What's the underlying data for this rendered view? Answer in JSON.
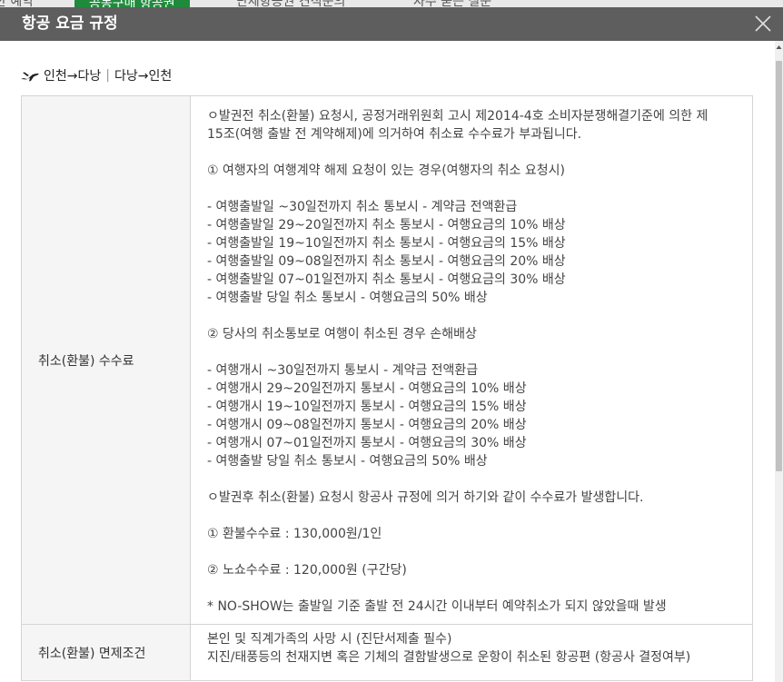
{
  "background_tabs": [
    "한 예약",
    "공동구매 항공권",
    "단체항공권 견적문의",
    "자주 묻는 질문"
  ],
  "modal": {
    "title": "항공 요금 규정",
    "close_icon": "close-icon"
  },
  "route": {
    "icon": "airplane-icon",
    "outbound": "인천→다낭",
    "separator": "|",
    "inbound": "다낭→인천"
  },
  "fare_rules": [
    {
      "label": "취소(환불) 수수료",
      "lines": [
        "ㅇ발권전 취소(환불) 요청시, 공정거래위원회 고시 제2014-4호 소비자분쟁해결기준에 의한 제",
        "15조(여행 출발 전 계약해제)에 의거하여 취소료 수수료가 부과됩니다.",
        "",
        "① 여행자의 여행계약 해제 요청이 있는 경우(여행자의 취소 요청시)",
        "",
        "- 여행출발일 ~30일전까지 취소 통보시 - 계약금 전액환급",
        "- 여행출발일 29~20일전까지 취소 통보시 - 여행요금의 10% 배상",
        "- 여행출발일 19~10일전까지 취소 통보시 - 여행요금의 15% 배상",
        "- 여행출발일 09~08일전까지 취소 통보시 - 여행요금의 20% 배상",
        "- 여행출발일 07~01일전까지 취소 통보시 - 여행요금의 30% 배상",
        "- 여행출발 당일 취소 통보시 - 여행요금의 50% 배상",
        "",
        "② 당사의 취소통보로 여행이 취소된 경우 손해배상",
        "",
        "- 여행개시 ~30일전까지 통보시 - 계약금 전액환급",
        "- 여행개시 29~20일전까지 통보시 - 여행요금의 10% 배상",
        "- 여행개시 19~10일전까지 통보시 - 여행요금의 15% 배상",
        "- 여행개시 09~08일전까지 통보시 - 여행요금의 20% 배상",
        "- 여행개시 07~01일전까지 통보시 - 여행요금의 30% 배상",
        "- 여행출발 당일 취소 통보시 - 여행요금의 50% 배상",
        "",
        "ㅇ발권후 취소(환불) 요청시 항공사 규정에 의거 하기와 같이 수수료가 발생합니다.",
        "",
        "① 환불수수료 : 130,000원/1인",
        "",
        "② 노쇼수수료 : 120,000원 (구간당)",
        "",
        "* NO-SHOW는 출발일 기준 출발 전 24시간 이내부터 예약취소가 되지 않았을때 발생"
      ]
    },
    {
      "label": "취소(환불) 면제조건",
      "lines": [
        "본인 및 직계가족의 사망 시 (진단서제출 필수)",
        "지진/태풍등의 천재지변 혹은 기체의 결함발생으로 운항이 취소된 항공편 (항공사 결정여부)"
      ]
    }
  ]
}
